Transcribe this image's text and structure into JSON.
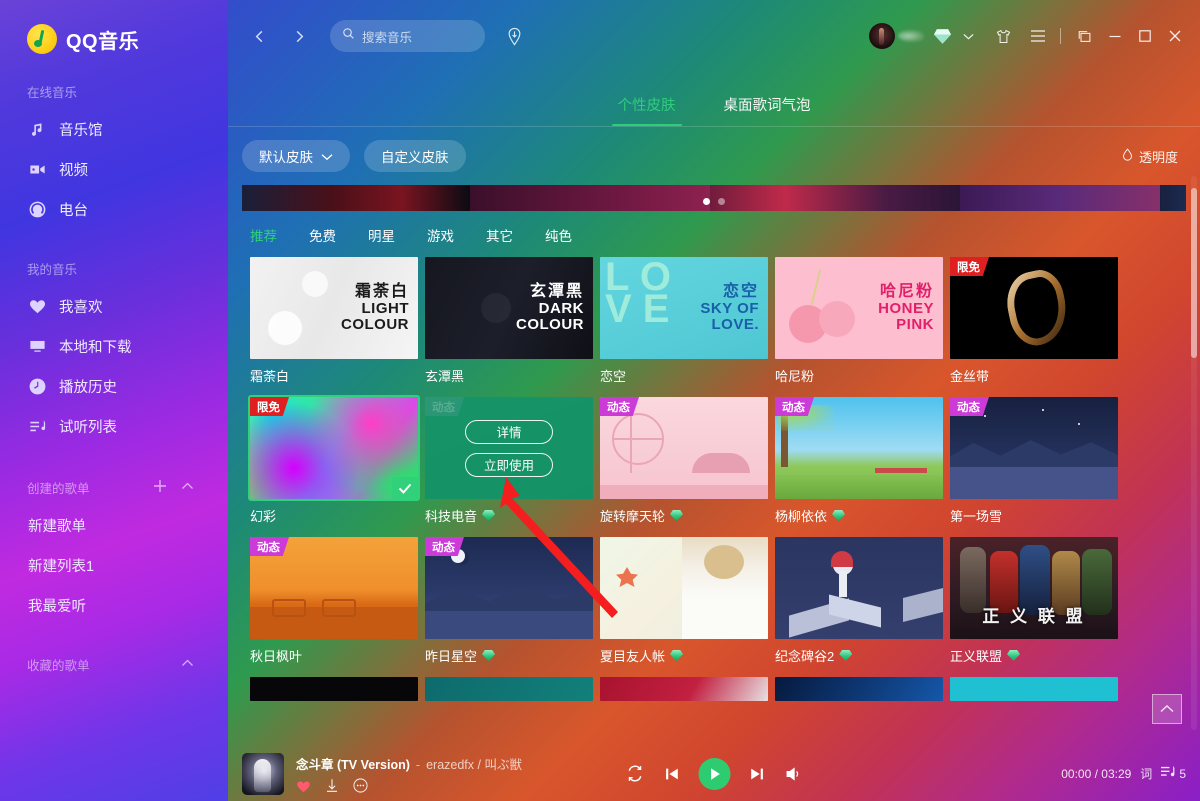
{
  "app": {
    "name": "QQ音乐",
    "logo_icon": "qq-music-note-logo"
  },
  "sidebar": {
    "groups": [
      {
        "title": "在线音乐",
        "items": [
          {
            "label": "音乐馆",
            "icon": "music-note-icon"
          },
          {
            "label": "视频",
            "icon": "video-camera-icon"
          },
          {
            "label": "电台",
            "icon": "radio-icon"
          }
        ]
      },
      {
        "title": "我的音乐",
        "items": [
          {
            "label": "我喜欢",
            "icon": "heart-icon"
          },
          {
            "label": "本地和下载",
            "icon": "monitor-icon"
          },
          {
            "label": "播放历史",
            "icon": "clock-icon"
          },
          {
            "label": "试听列表",
            "icon": "playlist-icon"
          }
        ]
      }
    ],
    "created_playlists": {
      "title": "创建的歌单",
      "add_icon": "plus-icon",
      "collapse_icon": "chevron-up-icon",
      "items": [
        "新建歌单",
        "新建列表1",
        "我最爱听"
      ]
    },
    "favorite_playlists": {
      "title": "收藏的歌单",
      "collapse_icon": "chevron-up-icon"
    }
  },
  "topbar": {
    "back_icon": "chevron-left-icon",
    "forward_icon": "chevron-right-icon",
    "search": {
      "placeholder": "搜索音乐",
      "icon": "search-icon",
      "value": ""
    },
    "download_icon": "download-circle-icon",
    "avatar_icon": "user-avatar",
    "vip_icon": "vip-swoosh-icon",
    "diamond_icon": "green-diamond-icon",
    "dropdown_icon": "chevron-down-icon",
    "skin_icon": "tshirt-skin-icon",
    "menu_icon": "hamburger-menu-icon",
    "mini_icon": "mini-mode-icon",
    "minimize_icon": "minimize-icon",
    "maximize_icon": "maximize-icon",
    "close_icon": "close-icon"
  },
  "page": {
    "tabs": [
      {
        "label": "个性皮肤",
        "active": true
      },
      {
        "label": "桌面歌词气泡",
        "active": false
      }
    ],
    "filters": [
      {
        "label": "默认皮肤",
        "icon": "chevron-down-icon",
        "has_caret": true
      },
      {
        "label": "自定义皮肤",
        "has_caret": false
      }
    ],
    "transparency": {
      "label": "透明度",
      "icon": "droplet-icon"
    },
    "banner_dots": [
      true,
      false
    ],
    "categories": [
      {
        "label": "推荐",
        "active": true
      },
      {
        "label": "免费",
        "active": false
      },
      {
        "label": "明星",
        "active": false
      },
      {
        "label": "游戏",
        "active": false
      },
      {
        "label": "其它",
        "active": false
      },
      {
        "label": "纯色",
        "active": false
      }
    ],
    "hover_overlay": {
      "detail_label": "详情",
      "use_label": "立即使用"
    },
    "scroll_top_icon": "chevron-up-icon",
    "skins": [
      {
        "label": "霜荼白",
        "badge": null,
        "vip": false,
        "art": "t-light",
        "title_cn": "霜荼白",
        "title_en1": "LIGHT",
        "title_en2": "COLOUR",
        "text_color": "#1b1b1b"
      },
      {
        "label": "玄潭黑",
        "badge": null,
        "vip": false,
        "art": "t-dark",
        "title_cn": "玄潭黑",
        "title_en1": "DARK",
        "title_en2": "COLOUR",
        "text_color": "#ffffff"
      },
      {
        "label": "恋空",
        "badge": null,
        "vip": false,
        "art": "t-sky",
        "title_cn": "恋空",
        "title_en1": "SKY OF",
        "title_en2": "LOVE.",
        "text_color": "#1a5fa8"
      },
      {
        "label": "哈尼粉",
        "badge": null,
        "vip": false,
        "art": "t-pink",
        "title_cn": "哈尼粉",
        "title_en1": "HONEY",
        "title_en2": "PINK",
        "text_color": "#e2206a"
      },
      {
        "label": "金丝带",
        "badge": "限免",
        "badge_type": "red",
        "vip": false,
        "art": "t-gold"
      },
      {
        "label": "幻彩",
        "badge": "限免",
        "badge_type": "red",
        "vip": false,
        "art": "t-rainbow",
        "selected": true
      },
      {
        "label": "科技电音",
        "badge": "动态",
        "badge_type": "muted",
        "vip": true,
        "art": "t-green",
        "hover": true
      },
      {
        "label": "旋转摩天轮",
        "badge": "动态",
        "badge_type": "purple",
        "vip": true,
        "art": "t-ferris"
      },
      {
        "label": "杨柳依依",
        "badge": "动态",
        "badge_type": "purple",
        "vip": true,
        "art": "t-willow"
      },
      {
        "label": "第一场雪",
        "badge": "动态",
        "badge_type": "purple",
        "vip": false,
        "art": "t-snow"
      },
      {
        "label": "秋日枫叶",
        "badge": "动态",
        "badge_type": "purple",
        "vip": false,
        "art": "t-autumn"
      },
      {
        "label": "昨日星空",
        "badge": "动态",
        "badge_type": "purple",
        "vip": true,
        "art": "t-night"
      },
      {
        "label": "夏目友人帐",
        "badge": null,
        "vip": true,
        "art": "t-natsume"
      },
      {
        "label": "纪念碑谷2",
        "badge": null,
        "vip": true,
        "art": "t-monument"
      },
      {
        "label": "正义联盟",
        "badge": null,
        "vip": true,
        "art": "t-justice"
      }
    ],
    "partial_skins": [
      "t-black2",
      "t-teal2",
      "t-red2",
      "t-blue2",
      "t-cyan2"
    ]
  },
  "player": {
    "song_title": "念斗章 (TV Version)",
    "separator": "-",
    "artist": "erazedfx / 叫ぶ獣",
    "favorite_icon": "heart-filled-icon",
    "download_icon": "download-arrow-icon",
    "more_icon": "more-dots-icon",
    "repeat_icon": "repeat-icon",
    "prev_icon": "previous-track-icon",
    "play_icon": "play-icon",
    "next_icon": "next-track-icon",
    "volume_icon": "volume-icon",
    "time_current": "00:00",
    "time_total": "03:29",
    "time_display": "00:00 / 03:29",
    "lyrics_label": "词",
    "queue_icon": "playlist-queue-icon",
    "queue_count": "5"
  }
}
